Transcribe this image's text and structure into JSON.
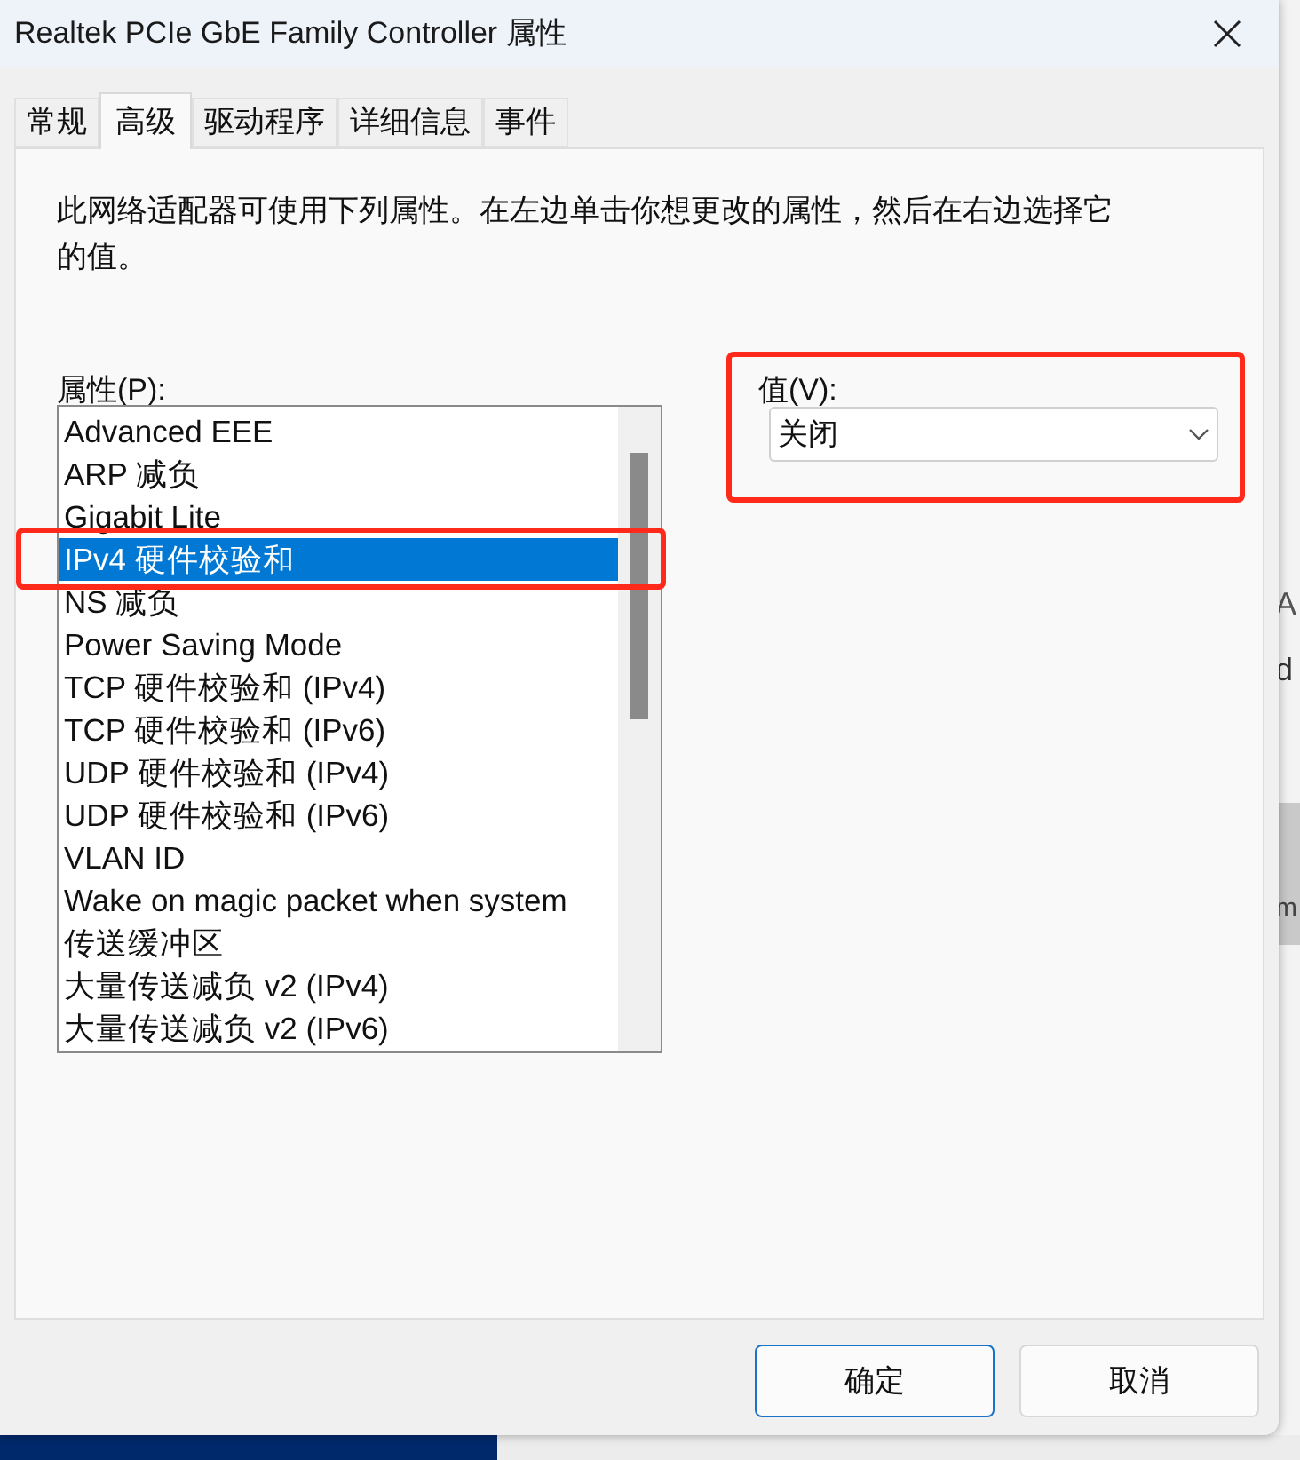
{
  "window": {
    "title": "Realtek PCIe GbE Family Controller 属性"
  },
  "tabs": [
    {
      "label": "常规",
      "selected": false
    },
    {
      "label": "高级",
      "selected": true
    },
    {
      "label": "驱动程序",
      "selected": false
    },
    {
      "label": "详细信息",
      "selected": false
    },
    {
      "label": "事件",
      "selected": false
    }
  ],
  "description": "此网络适配器可使用下列属性。在左边单击你想更改的属性，然后在右边选择它的值。",
  "property_label": "属性(P):",
  "properties": [
    {
      "label": "Advanced EEE",
      "selected": false
    },
    {
      "label": "ARP 减负",
      "selected": false
    },
    {
      "label": "Gigabit Lite",
      "selected": false
    },
    {
      "label": "IPv4 硬件校验和",
      "selected": true
    },
    {
      "label": "NS 减负",
      "selected": false
    },
    {
      "label": "Power Saving Mode",
      "selected": false
    },
    {
      "label": "TCP 硬件校验和 (IPv4)",
      "selected": false
    },
    {
      "label": "TCP 硬件校验和 (IPv6)",
      "selected": false
    },
    {
      "label": "UDP 硬件校验和 (IPv4)",
      "selected": false
    },
    {
      "label": "UDP 硬件校验和 (IPv6)",
      "selected": false
    },
    {
      "label": "VLAN ID",
      "selected": false
    },
    {
      "label": "Wake on magic packet when system",
      "selected": false
    },
    {
      "label": "传送缓冲区",
      "selected": false
    },
    {
      "label": "大量传送减负 v2 (IPv4)",
      "selected": false
    },
    {
      "label": "大量传送减负 v2 (IPv6)",
      "selected": false
    }
  ],
  "value_label": "值(V):",
  "value": "关闭",
  "buttons": [
    {
      "label": "确定",
      "default": true
    },
    {
      "label": "取消",
      "default": false
    }
  ],
  "background_window": {
    "fragments": [
      "A",
      "d",
      "m"
    ]
  }
}
